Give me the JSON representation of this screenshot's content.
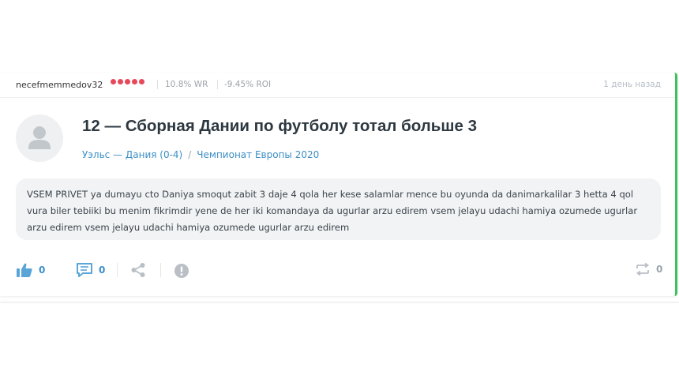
{
  "post": {
    "username": "necefmemmedov32",
    "rating_dots": 5,
    "win_rate": "10.8% WR",
    "roi": "-9.45% ROI",
    "time": "1 день назад",
    "title": "12 — Сборная Дании по футболу тотал больше 3",
    "match_link": "Уэльс — Дания (0-4)",
    "separator": "/",
    "tournament_link": "Чемпионат Европы 2020",
    "comment": "VSEM PRIVET ya dumayu cto Daniya smoqut zabit 3 daje 4 qola her kese salamlar mence bu oyunda da danimarkalilar 3 hetta 4 qol vura biler tebiiki bu menim fikrimdir yene de her iki komandaya da ugurlar arzu edirem vsem jelayu udachi hamiya ozumede ugurlar arzu edirem vsem jelayu udachi hamiya ozumede ugurlar arzu edirem",
    "likes": "0",
    "comments_count": "0",
    "reposts": "0"
  },
  "colors": {
    "accent_green": "#3cc25a",
    "dot_red": "#e8495a",
    "link_blue": "#3d8fc6",
    "icon_blue": "#5aa5d8",
    "icon_gray": "#b9bfc5"
  }
}
